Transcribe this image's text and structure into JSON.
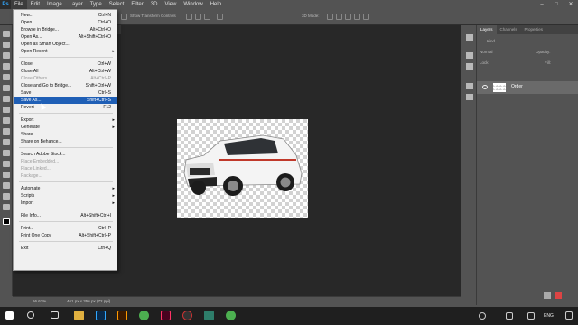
{
  "app": {
    "logo": "Ps"
  },
  "menubar": {
    "items": [
      "File",
      "Edit",
      "Image",
      "Layer",
      "Type",
      "Select",
      "Filter",
      "3D",
      "View",
      "Window",
      "Help"
    ],
    "controls": [
      "–",
      "□",
      "✕"
    ]
  },
  "options": {
    "transform_label": "Show Transform Controls",
    "mode_label": "3D Mode:"
  },
  "file_menu": {
    "items": [
      {
        "label": "New...",
        "shortcut": "Ctrl+N",
        "state": "normal"
      },
      {
        "label": "Open...",
        "shortcut": "Ctrl+O",
        "state": "normal"
      },
      {
        "label": "Browse in Bridge...",
        "shortcut": "Alt+Ctrl+O",
        "state": "normal"
      },
      {
        "label": "Open As...",
        "shortcut": "Alt+Shift+Ctrl+O",
        "state": "normal"
      },
      {
        "label": "Open as Smart Object...",
        "shortcut": "",
        "state": "normal"
      },
      {
        "label": "Open Recent",
        "shortcut": "",
        "state": "submenu"
      },
      {
        "label": "Close",
        "shortcut": "Ctrl+W",
        "state": "normal"
      },
      {
        "label": "Close All",
        "shortcut": "Alt+Ctrl+W",
        "state": "normal"
      },
      {
        "label": "Close Others",
        "shortcut": "Alt+Ctrl+P",
        "state": "disabled"
      },
      {
        "label": "Close and Go to Bridge...",
        "shortcut": "Shift+Ctrl+W",
        "state": "normal"
      },
      {
        "label": "Save",
        "shortcut": "Ctrl+S",
        "state": "normal"
      },
      {
        "label": "Save As...",
        "shortcut": "Shift+Ctrl+S",
        "state": "highlighted"
      },
      {
        "label": "Revert",
        "shortcut": "F12",
        "state": "normal"
      },
      {
        "label": "Export",
        "shortcut": "",
        "state": "submenu"
      },
      {
        "label": "Generate",
        "shortcut": "",
        "state": "submenu"
      },
      {
        "label": "Share...",
        "shortcut": "",
        "state": "normal"
      },
      {
        "label": "Share on Behance...",
        "shortcut": "",
        "state": "normal"
      },
      {
        "label": "Search Adobe Stock...",
        "shortcut": "",
        "state": "normal"
      },
      {
        "label": "Place Embedded...",
        "shortcut": "",
        "state": "disabled"
      },
      {
        "label": "Place Linked...",
        "shortcut": "",
        "state": "disabled"
      },
      {
        "label": "Package...",
        "shortcut": "",
        "state": "disabled"
      },
      {
        "label": "Automate",
        "shortcut": "",
        "state": "submenu"
      },
      {
        "label": "Scripts",
        "shortcut": "",
        "state": "submenu"
      },
      {
        "label": "Import",
        "shortcut": "",
        "state": "submenu"
      },
      {
        "label": "File Info...",
        "shortcut": "Alt+Shift+Ctrl+I",
        "state": "normal"
      },
      {
        "label": "Print...",
        "shortcut": "Ctrl+P",
        "state": "normal"
      },
      {
        "label": "Print One Copy",
        "shortcut": "Alt+Shift+Ctrl+P",
        "state": "normal"
      },
      {
        "label": "Exit",
        "shortcut": "Ctrl+Q",
        "state": "normal"
      }
    ]
  },
  "status": {
    "zoom": "66.67%",
    "doc_info": "461 px x 356 px (72 ppi)"
  },
  "layers_panel": {
    "tabs": [
      "Layers",
      "Channels",
      "Properties"
    ],
    "kind_label": "Kind",
    "blend_mode": "Normal",
    "opacity_label": "Opacity:",
    "lock_label": "Lock:",
    "fill_label": "Fill:",
    "layer_name": "Order"
  },
  "taskbar": {
    "language": "ENG",
    "time": "",
    "icons": [
      "windows-start",
      "search",
      "task-view",
      "file-explorer",
      "photoshop",
      "illustrator",
      "chrome",
      "indesign",
      "capture",
      "app",
      "chrome-2"
    ]
  },
  "colors": {
    "highlight": "#1f5fb6",
    "workspace": "#282828",
    "chrome": "#535353"
  }
}
